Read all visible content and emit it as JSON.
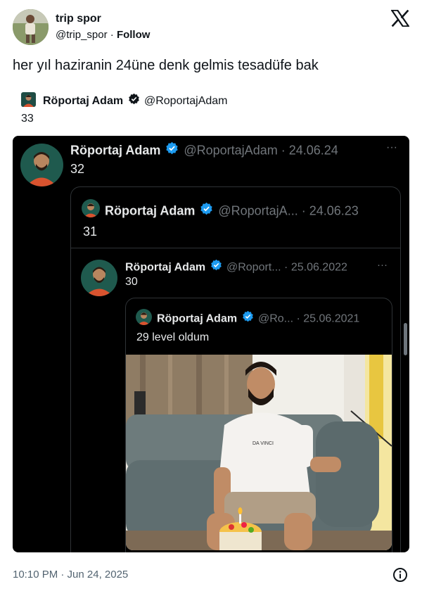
{
  "tweet": {
    "author_name": "trip spor",
    "author_handle": "@trip_spor",
    "follow_label": "Follow",
    "follow_sep": "·",
    "text": "her yıl haziranin 24üne denk gelmis tesadüfe bak",
    "timestamp": "10:10 PM · Jun 24, 2025",
    "brand_icon": "x-logo-icon",
    "info_icon": "info-icon"
  },
  "quoted": {
    "author_name": "Röportaj Adam",
    "author_handle": "@RoportajAdam",
    "text": "33"
  },
  "screenshot": {
    "post1": {
      "name": "Röportaj Adam",
      "handle": "@RoportajAdam",
      "date": "· 24.06.24",
      "text": "32",
      "more": "···"
    },
    "post2": {
      "name": "Röportaj Adam",
      "handle": "@RoportajA...",
      "date": "· 24.06.23",
      "text": "31"
    },
    "post3": {
      "name": "Röportaj Adam",
      "handle": "@Roport...",
      "date": "· 25.06.2022",
      "text": "30",
      "more": "···"
    },
    "post4": {
      "name": "Röportaj Adam",
      "handle": "@Ro...",
      "date": "· 25.06.2021",
      "text": "29 level oldum",
      "shirt_text": "DA VINCI"
    }
  },
  "colors": {
    "verified_blue": "#1d9bf0",
    "dark_bg": "#000000",
    "avatar_bg": "#d9532f"
  }
}
